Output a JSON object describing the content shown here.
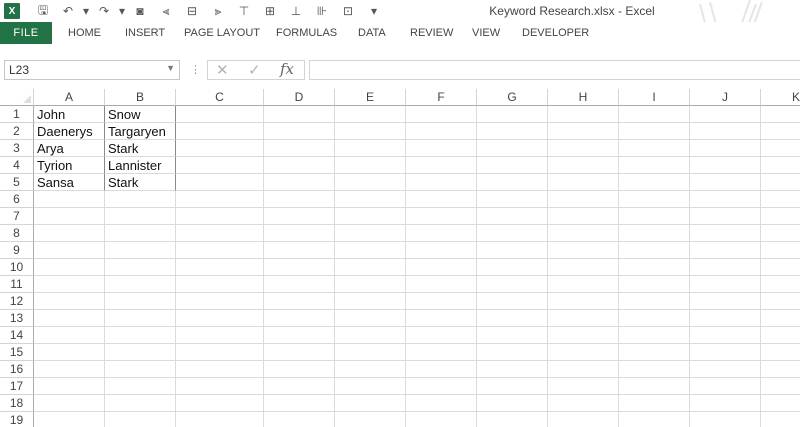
{
  "app": {
    "logo_text": "X",
    "window_title": "Keyword Research.xlsx - Excel",
    "accent_color": "#217346"
  },
  "quick_access": [
    {
      "name": "save-icon",
      "glyph": "🖫"
    },
    {
      "name": "undo-icon",
      "glyph": "↶"
    },
    {
      "name": "undo-dropdown-icon",
      "glyph": "▾"
    },
    {
      "name": "redo-icon",
      "glyph": "↷"
    },
    {
      "name": "redo-dropdown-icon",
      "glyph": "▾"
    },
    {
      "name": "camera-icon",
      "glyph": "◙"
    },
    {
      "name": "align-left-icon",
      "glyph": "⫷"
    },
    {
      "name": "align-center-icon",
      "glyph": "⊟"
    },
    {
      "name": "align-right-icon",
      "glyph": "⫸"
    },
    {
      "name": "align-top-icon",
      "glyph": "⊤"
    },
    {
      "name": "align-middle-icon",
      "glyph": "⊞"
    },
    {
      "name": "align-bottom-icon",
      "glyph": "⊥"
    },
    {
      "name": "distribute-icon",
      "glyph": "⊪"
    },
    {
      "name": "group-icon",
      "glyph": "⊡"
    },
    {
      "name": "customize-qat-icon",
      "glyph": "▾"
    }
  ],
  "ribbon": {
    "file_tab": "FILE",
    "tabs": [
      "HOME",
      "INSERT",
      "PAGE LAYOUT",
      "FORMULAS",
      "DATA",
      "REVIEW",
      "VIEW",
      "DEVELOPER"
    ]
  },
  "formula_bar": {
    "name_box": "L23",
    "cancel_glyph": "✕",
    "enter_glyph": "✓",
    "fx_label": "fx",
    "formula_value": ""
  },
  "sheet": {
    "columns": [
      "A",
      "B",
      "C",
      "D",
      "E",
      "F",
      "G",
      "H",
      "I",
      "J",
      "K"
    ],
    "rows": [
      "1",
      "2",
      "3",
      "4",
      "5",
      "6",
      "7",
      "8",
      "9",
      "10",
      "11",
      "12",
      "13",
      "14",
      "15",
      "16",
      "17",
      "18",
      "19"
    ],
    "cells": [
      [
        "John",
        "Snow"
      ],
      [
        "Daenerys",
        "Targaryen"
      ],
      [
        "Arya",
        "Stark"
      ],
      [
        "Tyrion",
        "Lannister"
      ],
      [
        "Sansa",
        "Stark"
      ]
    ]
  }
}
